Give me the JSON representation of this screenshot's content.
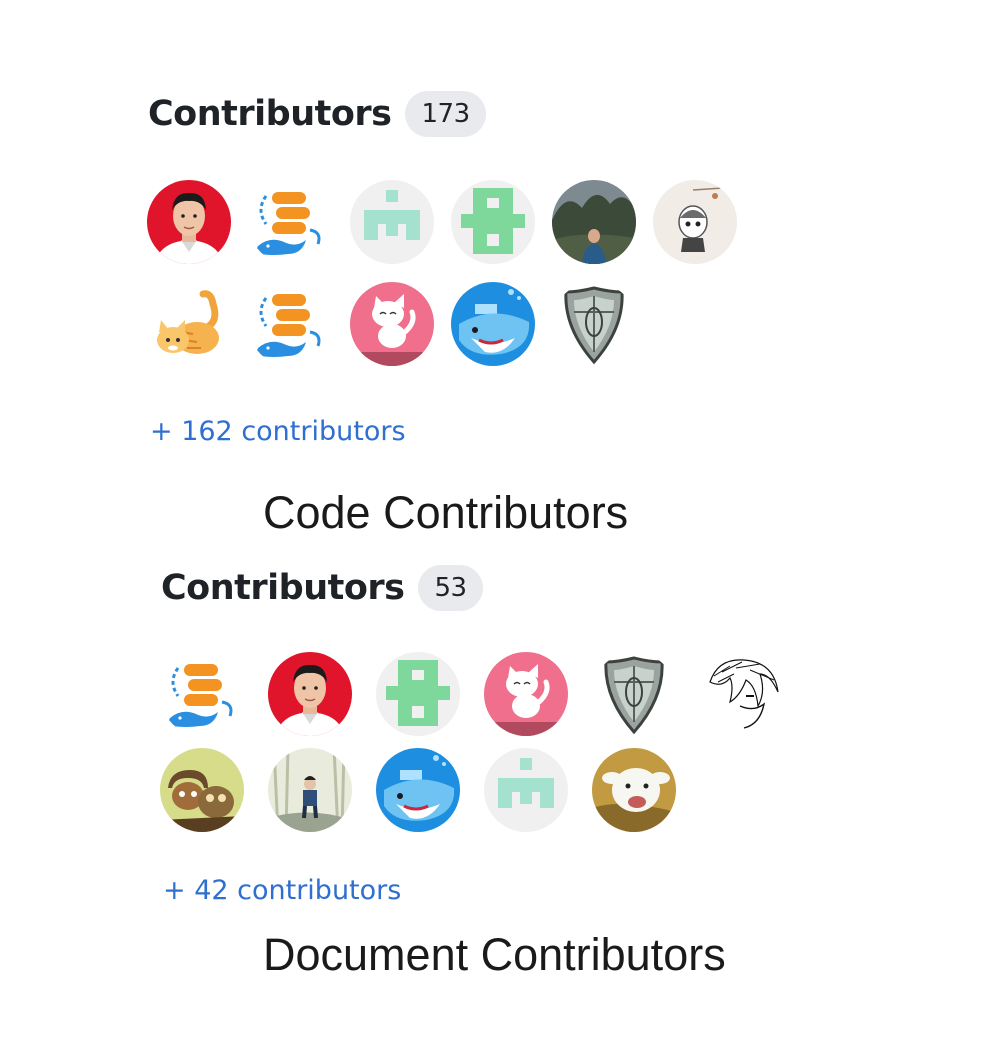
{
  "code_section": {
    "heading": "Contributors",
    "count": "173",
    "more_link": "+ 162 contributors",
    "caption": "Code Contributors",
    "avatars": [
      {
        "icon": "person-red-bg-avatar"
      },
      {
        "icon": "database-whale-logo-avatar"
      },
      {
        "icon": "mint-identicon-avatar"
      },
      {
        "icon": "green-identicon-avatar"
      },
      {
        "icon": "landscape-photo-avatar"
      },
      {
        "icon": "anime-figure-avatar"
      },
      {
        "icon": "orange-cat-avatar"
      },
      {
        "icon": "database-whale-logo-avatar"
      },
      {
        "icon": "pink-cat-avatar"
      },
      {
        "icon": "blue-whale-avatar"
      },
      {
        "icon": "shield-avatar"
      }
    ]
  },
  "doc_section": {
    "heading": "Contributors",
    "count": "53",
    "more_link": "+ 42 contributors",
    "caption": "Document Contributors",
    "avatars": [
      {
        "icon": "database-whale-logo-avatar"
      },
      {
        "icon": "person-red-bg-avatar"
      },
      {
        "icon": "green-identicon-avatar"
      },
      {
        "icon": "pink-cat-avatar"
      },
      {
        "icon": "shield-avatar"
      },
      {
        "icon": "manga-sketch-avatar"
      },
      {
        "icon": "cartoon-animals-avatar"
      },
      {
        "icon": "forest-person-avatar"
      },
      {
        "icon": "blue-whale-avatar"
      },
      {
        "icon": "mint-identicon-avatar"
      },
      {
        "icon": "goat-photo-avatar"
      }
    ]
  },
  "colors": {
    "link": "#2f6fcf",
    "badge_bg": "#e8eaee",
    "heading_text": "#1f2328"
  }
}
